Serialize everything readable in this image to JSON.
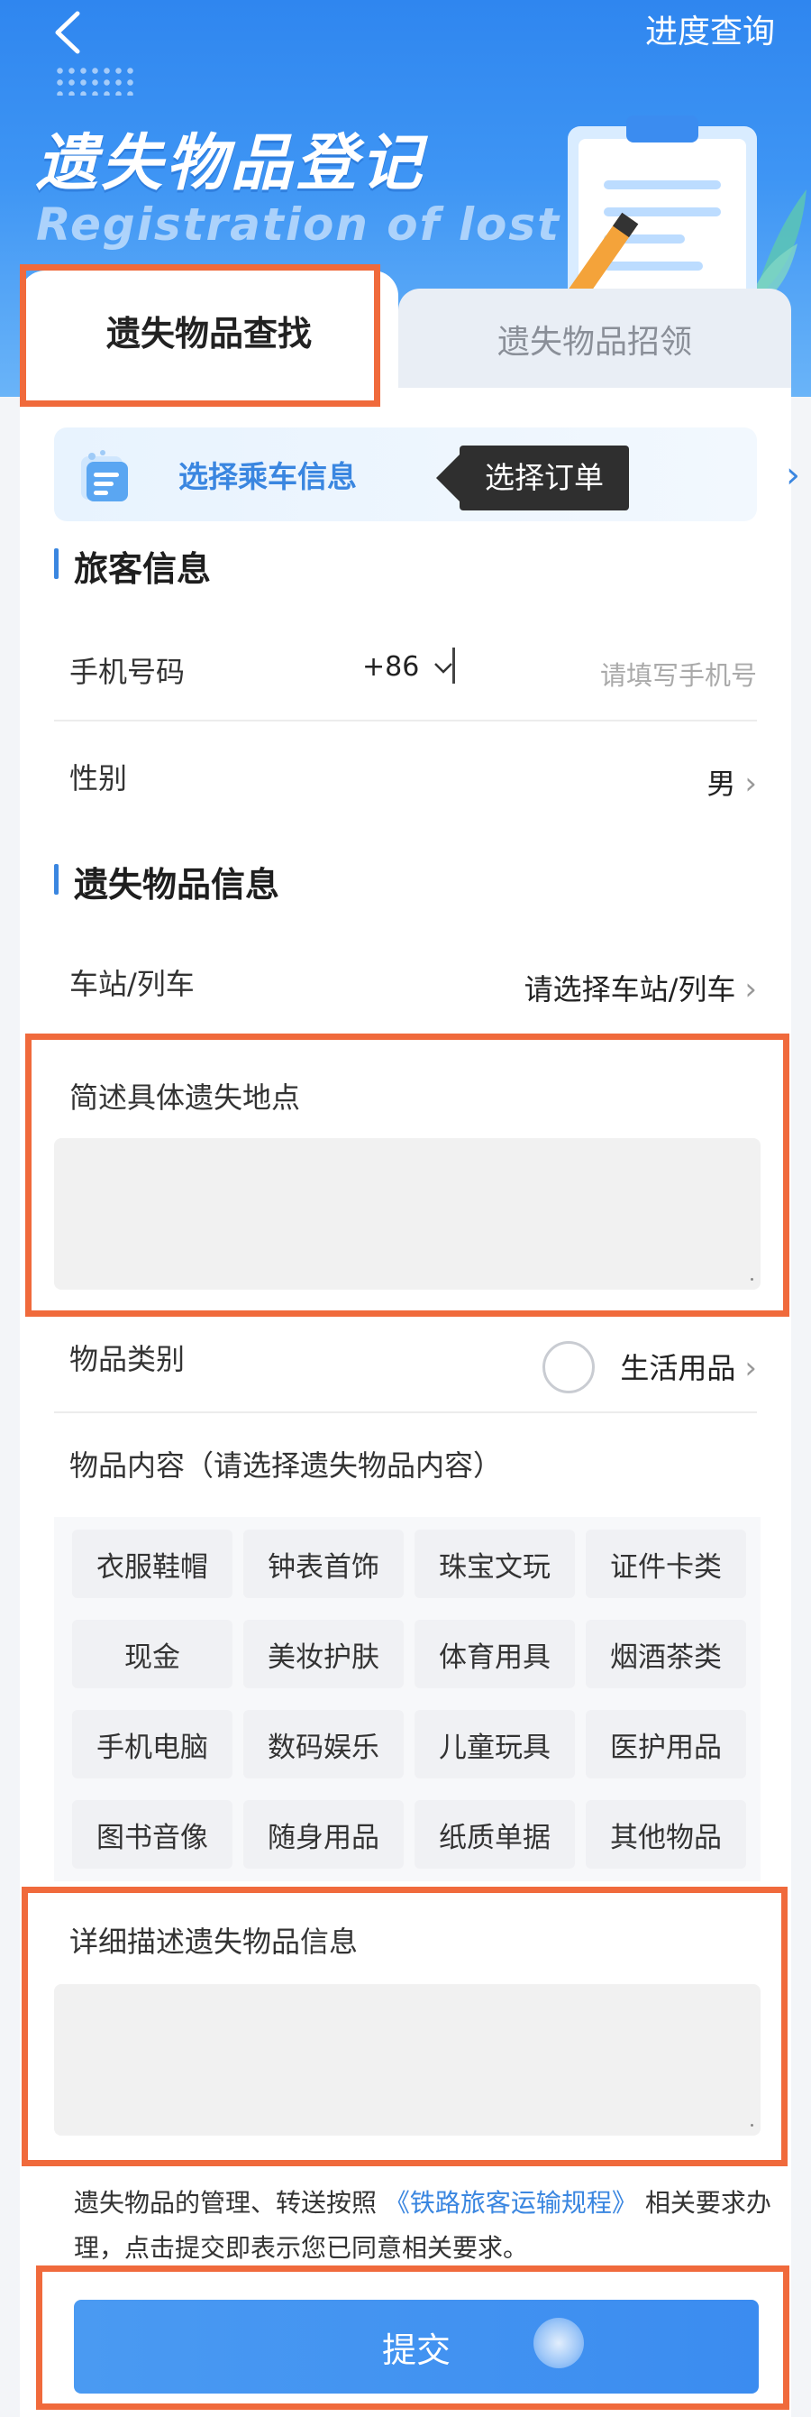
{
  "header": {
    "back_icon": "chevron-left-icon",
    "progress_link": "进度查询",
    "title": "遗失物品登记",
    "subtitle": "Registration of lost"
  },
  "tabs": [
    {
      "label": "遗失物品查找",
      "active": true
    },
    {
      "label": "遗失物品招领",
      "active": false
    }
  ],
  "trip": {
    "label": "选择乘车信息",
    "tooltip": "选择订单",
    "chevron": "›"
  },
  "passenger": {
    "section_title": "旅客信息",
    "phone_label": "手机号码",
    "country_code": "+86",
    "phone_placeholder": "请填写手机号",
    "gender_label": "性别",
    "gender_value": "男"
  },
  "lost_item": {
    "section_title": "遗失物品信息",
    "station_label": "车站/列车",
    "station_value": "请选择车站/列车",
    "location_label": "简述具体遗失地点",
    "category_label": "物品类别",
    "category_value": "生活用品",
    "content_label": "物品内容（请选择遗失物品内容）",
    "content_options": [
      "衣服鞋帽",
      "钟表首饰",
      "珠宝文玩",
      "证件卡类",
      "现金",
      "美妆护肤",
      "体育用具",
      "烟酒茶类",
      "手机电脑",
      "数码娱乐",
      "儿童玩具",
      "医护用品",
      "图书音像",
      "随身用品",
      "纸质单据",
      "其他物品"
    ],
    "detail_label": "详细描述遗失物品信息"
  },
  "notice": {
    "prefix": "遗失物品的管理、转送按照",
    "link": "《铁路旅客运输规程》",
    "suffix": "相关要求办理，点击提交即表示您已同意相关要求。"
  },
  "submit_label": "提交",
  "colors": {
    "accent": "#3a86e0",
    "highlight": "#f06a3c",
    "header_blue": "#2f86ef"
  }
}
